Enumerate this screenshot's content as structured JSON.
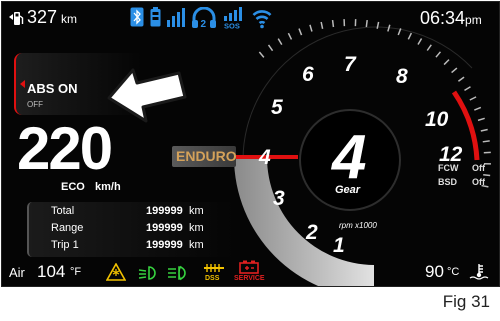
{
  "top_bar": {
    "fuel_icon": "fuel-pump-icon",
    "range_value": "327",
    "range_unit": "km",
    "status_icons": [
      "bluetooth-icon",
      "phone-battery-icon",
      "phone-signal-icon",
      "headset-icon",
      "sos-signal-icon",
      "wifi-icon"
    ],
    "clock_time": "06:34",
    "clock_ampm": "pm"
  },
  "notification": {
    "title": "ABS ON",
    "subtitle": "OFF"
  },
  "speed": {
    "value": "220",
    "mode": "ECO",
    "unit": "km/h"
  },
  "riding_mode": "ENDURO",
  "tachometer": {
    "scale_labels": [
      "1",
      "2",
      "3",
      "4",
      "5",
      "6",
      "7",
      "8",
      "10",
      "12"
    ],
    "unit_label": "rpm x1000",
    "gear": "4",
    "gear_label": "Gear"
  },
  "assist": [
    {
      "name": "FCW",
      "state": "Off"
    },
    {
      "name": "BSD",
      "state": "Off"
    }
  ],
  "trip_info": [
    {
      "label": "Total",
      "value": "199999",
      "unit": "km"
    },
    {
      "label": "Range",
      "value": "199999",
      "unit": "km"
    },
    {
      "label": "Trip 1",
      "value": "199999",
      "unit": "km"
    }
  ],
  "bottom_bar": {
    "air_label": "Air",
    "air_temp": "104",
    "air_unit": "°F",
    "indicators": [
      {
        "icon": "road-ice-warning-icon",
        "color": "#f2c200"
      },
      {
        "icon": "low-beam-icon",
        "color": "#36d13f"
      },
      {
        "icon": "fog-light-icon",
        "color": "#36d13f"
      },
      {
        "icon": "dss-icon",
        "label": "DSS",
        "color": "#f2c200"
      },
      {
        "icon": "service-icon",
        "label": "SERVICE",
        "color": "#e02020"
      }
    ],
    "coolant_temp": "90",
    "coolant_unit": "°C",
    "coolant_icon": "coolant-temperature-icon"
  },
  "figure_caption": "Fig 31",
  "colors": {
    "accent_red": "#e01010",
    "icon_blue": "#2b8fe6",
    "indicator_green": "#36d13f",
    "indicator_yellow": "#f2c200",
    "background": "#050505"
  }
}
